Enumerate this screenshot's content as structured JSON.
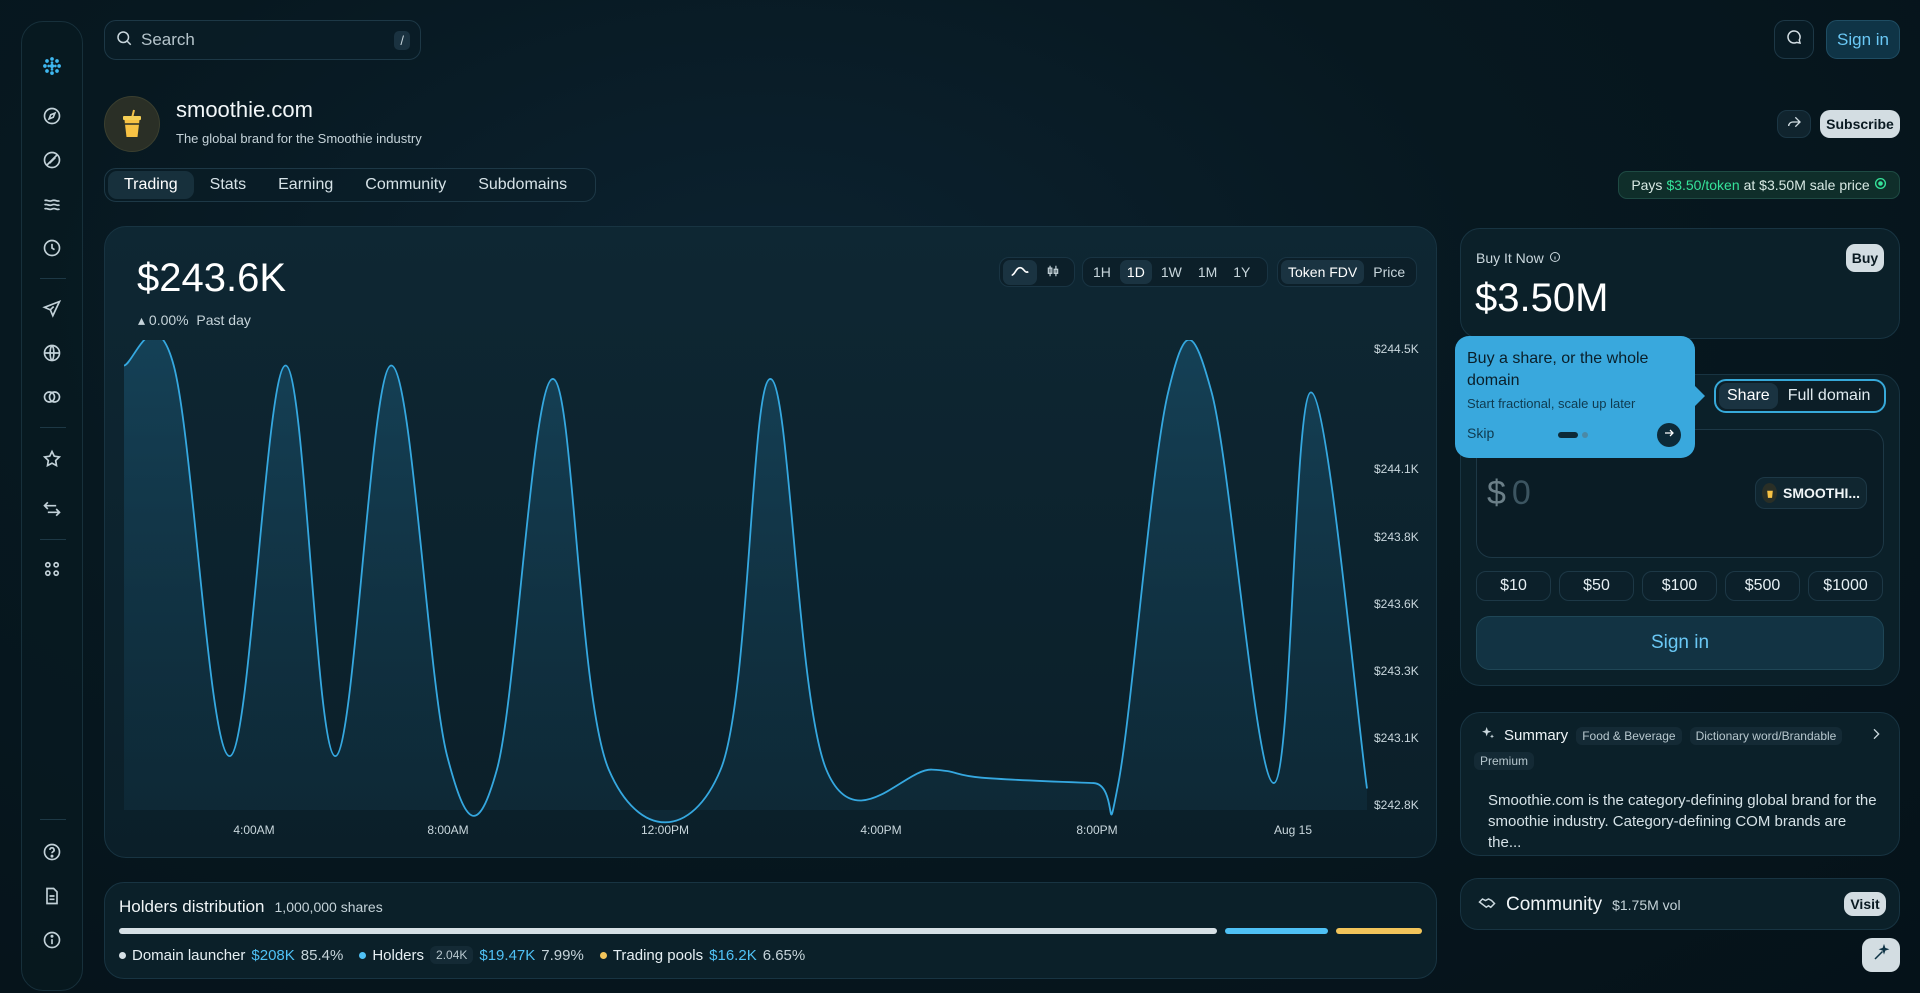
{
  "search": {
    "placeholder": "Search",
    "shortcut": "/"
  },
  "topbar": {
    "signin_label": "Sign in"
  },
  "header": {
    "domain": "smoothie.com",
    "tagline": "The global brand for the Smoothie industry",
    "subscribe_label": "Subscribe"
  },
  "tabs": [
    {
      "label": "Trading",
      "active": true
    },
    {
      "label": "Stats",
      "active": false
    },
    {
      "label": "Earning",
      "active": false
    },
    {
      "label": "Community",
      "active": false
    },
    {
      "label": "Subdomains",
      "active": false
    }
  ],
  "pays": {
    "prefix": "Pays",
    "rate": "$3.50/token",
    "suffix": "at $3.50M sale price"
  },
  "chart_panel": {
    "value": "$243.6K",
    "change": "▴ 0.00%",
    "change_period": "Past day",
    "ranges": [
      "1H",
      "1D",
      "1W",
      "1M",
      "1Y"
    ],
    "active_range": "1D",
    "metrics": [
      "Token FDV",
      "Price"
    ],
    "active_metric": "Token FDV"
  },
  "chart_data": {
    "type": "area",
    "x_ticks": [
      "4:00AM",
      "8:00AM",
      "12:00PM",
      "4:00PM",
      "8:00PM",
      "Aug 15"
    ],
    "y_ticks": [
      "$244.5K",
      "$244.1K",
      "$243.8K",
      "$243.6K",
      "$243.3K",
      "$243.1K",
      "$242.8K"
    ],
    "ylim": [
      242.8,
      244.5
    ],
    "series": [
      {
        "values": [
          [
            0.0,
            244.45
          ],
          [
            0.04,
            244.45
          ],
          [
            0.085,
            243.0
          ],
          [
            0.13,
            244.45
          ],
          [
            0.17,
            243.0
          ],
          [
            0.215,
            244.45
          ],
          [
            0.26,
            243.0
          ],
          [
            0.3,
            242.95
          ],
          [
            0.345,
            244.4
          ],
          [
            0.39,
            242.95
          ],
          [
            0.48,
            242.95
          ],
          [
            0.52,
            244.4
          ],
          [
            0.565,
            242.95
          ],
          [
            0.65,
            242.95
          ],
          [
            0.69,
            242.92
          ],
          [
            0.78,
            242.9
          ],
          [
            0.8,
            242.9
          ],
          [
            0.84,
            244.35
          ],
          [
            0.875,
            244.35
          ],
          [
            0.925,
            242.9
          ],
          [
            0.955,
            244.35
          ],
          [
            1.0,
            242.88
          ]
        ]
      }
    ]
  },
  "buy_now": {
    "label": "Buy It Now",
    "price": "$3.50M",
    "buy_label": "Buy"
  },
  "tooltip": {
    "title": "Buy a share, or the whole domain",
    "subtitle": "Start fractional, scale up later",
    "skip_label": "Skip"
  },
  "trade": {
    "options": [
      "Share",
      "Full domain"
    ],
    "active_option": "Share",
    "currency": "$",
    "amount_placeholder": "0",
    "token": "SMOOTHI...",
    "quick_amounts": [
      "$10",
      "$50",
      "$100",
      "$500",
      "$1000"
    ],
    "signin_label": "Sign in"
  },
  "summary": {
    "title": "Summary",
    "tags": [
      "Food & Beverage",
      "Dictionary word/Brandable",
      "Premium"
    ],
    "text": "Smoothie.com is the category-defining global brand for the smoothie industry. Category-defining COM brands are the..."
  },
  "community": {
    "title": "Community",
    "volume": "$1.75M vol",
    "visit_label": "Visit"
  },
  "holders": {
    "title": "Holders distribution",
    "shares": "1,000,000 shares",
    "segments": [
      {
        "label": "Domain launcher",
        "value": "$208K",
        "pct": "85.4%",
        "fraction": 0.854,
        "color": "#d6e0e5"
      },
      {
        "label": "Holders",
        "count": "2.04K",
        "value": "$19.47K",
        "pct": "7.99%",
        "fraction": 0.0799,
        "color": "#4fc1f5"
      },
      {
        "label": "Trading pools",
        "value": "$16.2K",
        "pct": "6.65%",
        "fraction": 0.0665,
        "color": "#f2c45a"
      }
    ]
  },
  "colors": {
    "accent": "#4fc1f5",
    "green": "#35e39a",
    "line": "#35a8e0"
  },
  "icons": {
    "sidebar_top": [
      "app-logo-icon",
      "compass-icon",
      "ban-icon",
      "waves-icon",
      "clock-icon",
      "send-icon",
      "globe-icon",
      "coins-icon",
      "star-icon",
      "swap-icon",
      "grid-icon"
    ],
    "sidebar_bottom": [
      "help-icon",
      "document-icon",
      "info-icon"
    ]
  }
}
